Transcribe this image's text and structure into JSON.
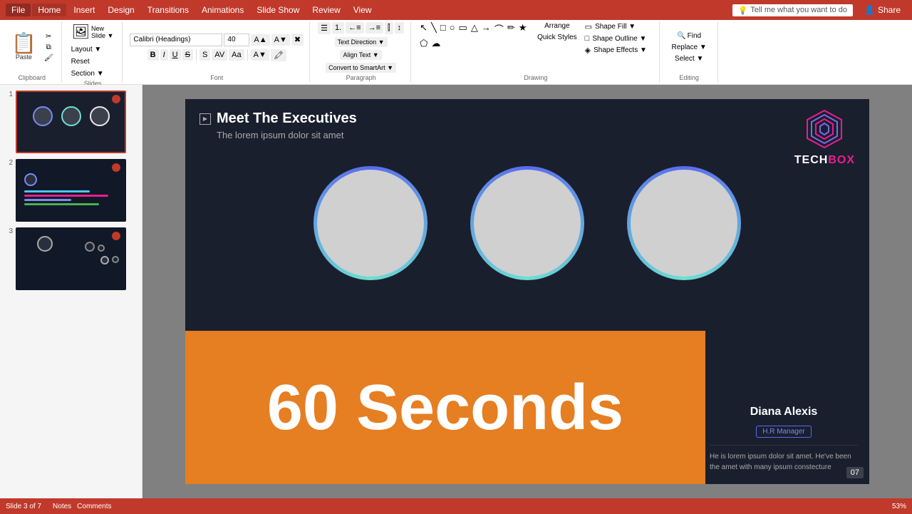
{
  "menubar": {
    "file": "File",
    "tabs": [
      "Home",
      "Insert",
      "Design",
      "Transitions",
      "Animations",
      "Slide Show",
      "Review",
      "View"
    ],
    "active_tab": "Home",
    "tell_me": "Tell me what you want to do",
    "share": "Share"
  },
  "ribbon": {
    "groups": {
      "clipboard": {
        "label": "Clipboard",
        "paste": "Paste",
        "cut": "✂",
        "copy": "⧉",
        "format_painter": "🖌"
      },
      "slides": {
        "label": "Slides",
        "new_slide": "New Slide",
        "layout": "Layout ▼",
        "reset": "Reset",
        "section": "Section ▼"
      },
      "font": {
        "label": "Font",
        "font_name": "",
        "font_size": "",
        "bold": "B",
        "italic": "I",
        "underline": "U",
        "strikethrough": "S",
        "shadow": "S"
      },
      "paragraph": {
        "label": "Paragraph"
      },
      "drawing": {
        "label": "Drawing"
      },
      "editing": {
        "label": "Editing",
        "find": "Find",
        "replace": "Replace ▼",
        "select": "Select ▼"
      }
    }
  },
  "toolbar": {
    "text_direction": "Text Direction ▼",
    "align_text": "Align Text ▼",
    "convert_smartart": "Convert to SmartArt ▼",
    "arrange": "Arrange",
    "quick_styles": "Quick Styles",
    "shape_fill": "Shape Fill ▼",
    "shape_outline": "Shape Outline ▼",
    "shape_effects": "Shape Effects ▼",
    "section_label": "Section ▼"
  },
  "slide_panel": {
    "slides": [
      {
        "num": 1,
        "active": true,
        "has_dot": true
      },
      {
        "num": 2,
        "active": false,
        "has_dot": true
      },
      {
        "num": 3,
        "active": false,
        "has_dot": true
      }
    ]
  },
  "slide": {
    "play_icon": "▶",
    "title": "Meet The Executives",
    "subtitle": "The lorem ipsum dolor sit amet",
    "logo_text_white": "TECH",
    "logo_text_pink": "BOX",
    "circles": [
      {},
      {},
      {}
    ],
    "timer": "60 Seconds",
    "person": {
      "name": "Diana Alexis",
      "badge": "H.R Manager",
      "desc": "He is lorem ipsum dolor sit amet. He've been the amet with many ipsum constecture",
      "slide_num": "07"
    }
  },
  "status_bar": {
    "slide_info": "Slide 3 of 7",
    "notes": "Notes",
    "comments": "Comments",
    "zoom": "53%"
  }
}
